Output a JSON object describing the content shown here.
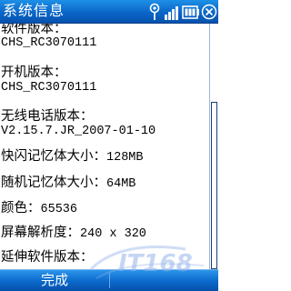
{
  "titlebar": {
    "title": "系统信息",
    "icons": [
      "antenna-signal-icon",
      "network-icon",
      "battery-icon",
      "close-icon"
    ]
  },
  "info": [
    {
      "label": "软件版本：",
      "value": "CHS_RC3070111"
    },
    {
      "label": "开机版本：",
      "value": "CHS_RC3070111"
    },
    {
      "label": "无线电话版本：",
      "value": "V2.15.7.JR_2007-01-10"
    },
    {
      "label": "快闪记忆体大小：",
      "value": "128MB"
    },
    {
      "label": "随机记忆体大小：",
      "value": "64MB"
    },
    {
      "label": "颜色：",
      "value": "65536"
    },
    {
      "label": "屏幕解析度：",
      "value": "240 x 320"
    },
    {
      "label": "延伸软件版本：",
      "value": ""
    }
  ],
  "softkeys": {
    "left": "完成"
  },
  "watermark": {
    "text": "IT168",
    "icon": "watermark-logo-icon"
  },
  "colors": {
    "titlebar": "#0a66c8",
    "softbar": "#0a68ca",
    "text": "#000000",
    "background": "#ffffff"
  }
}
